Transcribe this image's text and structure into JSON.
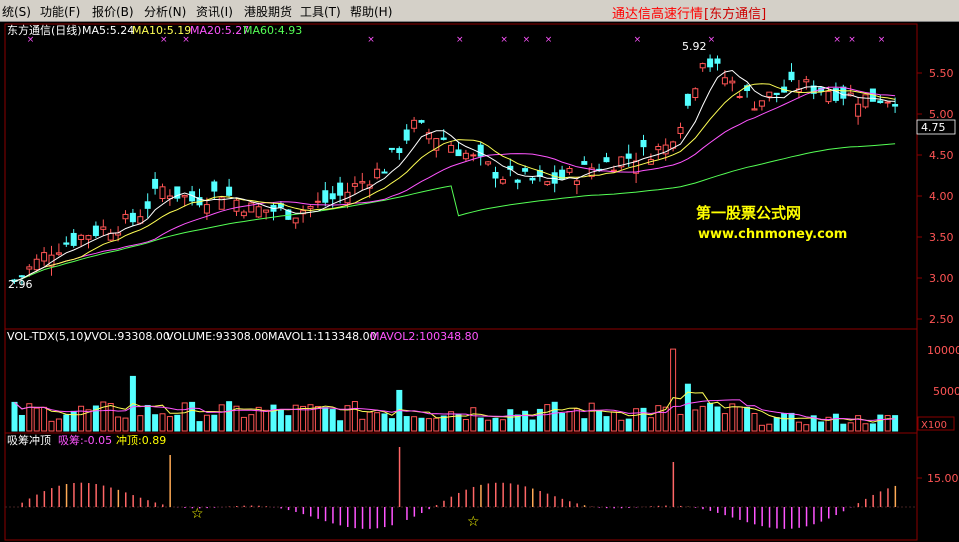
{
  "menu": {
    "items": [
      "统(S)",
      "功能(F)",
      "报价(B)",
      "分析(N)",
      "资讯(I)",
      "港股期货",
      "工具(T)",
      "帮助(H)"
    ],
    "title": "通达信高速行情",
    "broker": "[东方通信]"
  },
  "price_panel": {
    "stock_label": "东方通信(日线)",
    "indicators": [
      {
        "text": "MA5:5.24",
        "color": "#ffffff"
      },
      {
        "text": "MA10:5.19",
        "color": "#ffff55"
      },
      {
        "text": "MA20:5.27",
        "color": "#ff55ff"
      },
      {
        "text": "MA60:4.93",
        "color": "#55ff55"
      }
    ],
    "y_ticks": [
      "5.50",
      "5.00",
      "4.50",
      "4.00",
      "3.50",
      "3.00",
      "2.50"
    ],
    "current_price": "4.75",
    "high_label": "5.92",
    "low_label": "2.96",
    "watermark_title": "第一股票公式网",
    "watermark_url": "www.chnmoney.com"
  },
  "volume_panel": {
    "indicators": [
      {
        "text": "VOL-TDX(5,10)",
        "color": "#ffffff"
      },
      {
        "text": "VVOL:93308.00",
        "color": "#ffffff"
      },
      {
        "text": "VOLUME:93308.00",
        "color": "#ffffff"
      },
      {
        "text": "MAVOL1:113348.00",
        "color": "#ffffff"
      },
      {
        "text": "MAVOL2:100348.80",
        "color": "#ff55ff"
      }
    ],
    "y_ticks": [
      "10000",
      "5000"
    ],
    "unit": "X100"
  },
  "osc_panel": {
    "indicators": [
      {
        "text": "吸筹冲顶",
        "color": "#ffffff"
      },
      {
        "text": "吸筹:-0.05",
        "color": "#ff55ff"
      },
      {
        "text": "冲顶:0.89",
        "color": "#ffff00"
      }
    ],
    "y_ticks": [
      "15.00"
    ]
  },
  "colors": {
    "up": "#ff5555",
    "down": "#54ffff",
    "grid": "#8b0000",
    "ma5": "#ffffff",
    "ma10": "#ffff55",
    "ma20": "#ff55ff",
    "ma60": "#55ff55"
  }
}
